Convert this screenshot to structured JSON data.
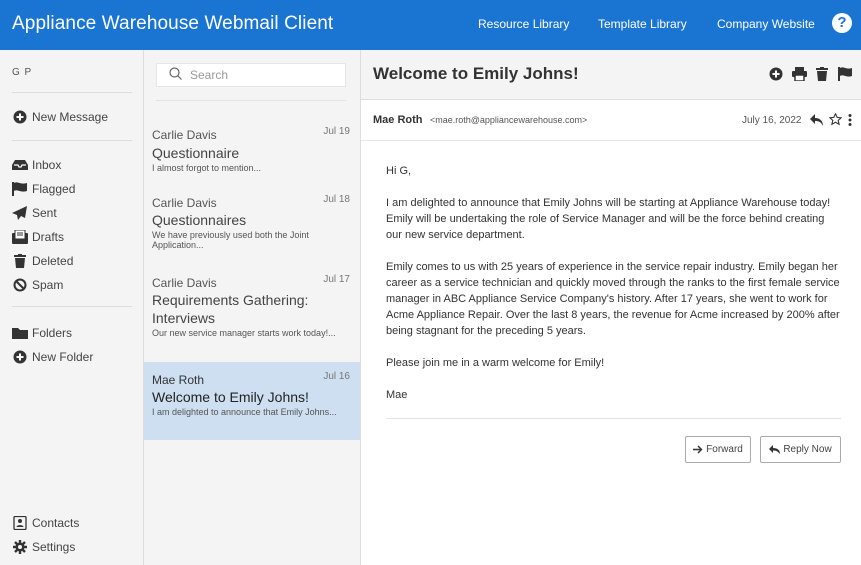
{
  "app": {
    "title": "Appliance Warehouse Webmail Client"
  },
  "topnav": {
    "links": [
      "Resource Library",
      "Template Library",
      "Company Website"
    ],
    "help": "?"
  },
  "user": {
    "initials": "G P"
  },
  "sidebar": {
    "new_message": "New Message",
    "folders": [
      {
        "label": "Inbox",
        "icon": "inbox-icon"
      },
      {
        "label": "Flagged",
        "icon": "flag-icon"
      },
      {
        "label": "Sent",
        "icon": "send-icon"
      },
      {
        "label": "Drafts",
        "icon": "drafts-icon"
      },
      {
        "label": "Deleted",
        "icon": "trash-icon"
      },
      {
        "label": "Spam",
        "icon": "ban-icon"
      }
    ],
    "folders_label": "Folders",
    "new_folder": "New Folder",
    "contacts": "Contacts",
    "settings": "Settings"
  },
  "search": {
    "placeholder": "Search"
  },
  "messages": [
    {
      "from": "Carlie Davis",
      "date": "Jul 19",
      "subject": "Questionnaire",
      "preview": "I almost forgot to mention..."
    },
    {
      "from": "Carlie Davis",
      "date": "Jul 18",
      "subject": "Questionnaires",
      "preview": "We have previously used both the Joint Application..."
    },
    {
      "from": "Carlie Davis",
      "date": "Jul 17",
      "subject": "Requirements Gathering: Interviews",
      "preview": "Our new service manager starts work today!..."
    },
    {
      "from": "Mae Roth",
      "date": "Jul 16",
      "subject": "Welcome to Emily Johns!",
      "preview": "I am delighted to announce that Emily Johns..."
    }
  ],
  "email": {
    "subject": "Welcome to Emily Johns!",
    "sender_name": "Mae Roth",
    "sender_email": "<mae.roth@appliancewarehouse.com>",
    "date": "July 16, 2022",
    "greeting": "Hi G,",
    "paragraphs": [
      "I am delighted to announce that Emily Johns will be starting at Appliance Warehouse today! Emily will be undertaking the role of Service Manager and will be the force behind creating our new service department.",
      "Emily comes to us with 25 years of experience in the service repair industry. Emily began her career as a service technician and quickly moved through the ranks to the first female service manager in ABC Appliance Service Company's history. After 17 years, she went to work for Acme Appliance Repair. Over the last 8 years, the revenue for Acme increased by 200% after being stagnant for the preceding 5 years.",
      "Please join me in a warm welcome for Emily!"
    ],
    "signature": "Mae",
    "forward_label": "Forward",
    "reply_label": "Reply Now"
  }
}
